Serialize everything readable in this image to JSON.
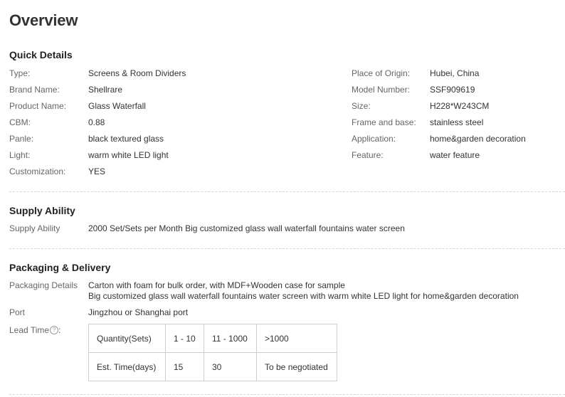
{
  "header": {
    "title": "Overview"
  },
  "quick_details": {
    "title": "Quick Details",
    "left": [
      {
        "label": "Type:",
        "value": "Screens & Room Dividers"
      },
      {
        "label": "Brand Name:",
        "value": "Shellrare"
      },
      {
        "label": "Product Name:",
        "value": "Glass Waterfall"
      },
      {
        "label": "CBM:",
        "value": "0.88"
      },
      {
        "label": "Panle:",
        "value": "black textured glass"
      },
      {
        "label": "Light:",
        "value": "warm white LED light"
      },
      {
        "label": "Customization:",
        "value": "YES"
      }
    ],
    "right": [
      {
        "label": "Place of Origin:",
        "value": "Hubei, China"
      },
      {
        "label": "Model Number:",
        "value": "SSF909619"
      },
      {
        "label": "Size:",
        "value": "H228*W243CM"
      },
      {
        "label": "Frame and base:",
        "value": "stainless steel"
      },
      {
        "label": "Application:",
        "value": "home&garden decoration"
      },
      {
        "label": "Feature:",
        "value": "water feature"
      }
    ]
  },
  "supply": {
    "title": "Supply Ability",
    "label": "Supply Ability",
    "value": "2000 Set/Sets per Month Big customized glass wall waterfall fountains water screen"
  },
  "packaging": {
    "title": "Packaging & Delivery",
    "details_label": "Packaging Details",
    "details_line1": "Carton with foam for bulk order, with MDF+Wooden case for sample",
    "details_line2": "Big customized glass wall waterfall fountains water screen with warm white LED light for home&garden decoration",
    "port_label": "Port",
    "port_value": "Jingzhou or Shanghai port",
    "lead_time_label": "Lead Time",
    "lead_time_suffix": ":",
    "help_glyph": "?",
    "help_icon": "question-circle-icon",
    "lead_table": {
      "row1": [
        "Quantity(Sets)",
        "1 - 10",
        "11 - 1000",
        ">1000"
      ],
      "row2": [
        "Est. Time(days)",
        "15",
        "30",
        "To be negotiated"
      ]
    }
  }
}
